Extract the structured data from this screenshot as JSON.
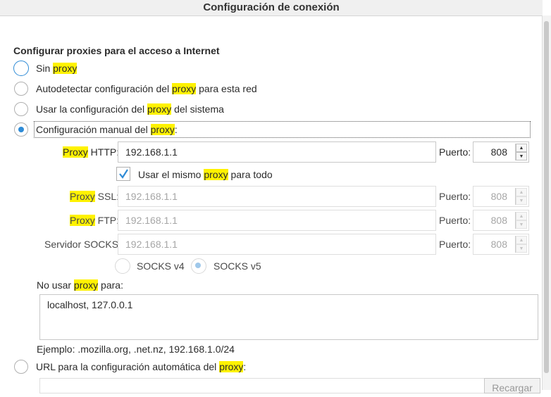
{
  "dialog": {
    "title": "Configuración de conexión"
  },
  "section": {
    "title": "Configurar proxies para el acceso a Internet"
  },
  "options": {
    "no_proxy": {
      "pre": "Sin ",
      "hl": "proxy",
      "post": ""
    },
    "auto_detect": {
      "pre": "Autodetectar configuración del ",
      "hl": "proxy",
      "post": " para esta red"
    },
    "system": {
      "pre": "Usar la configuración del ",
      "hl": "proxy",
      "post": " del sistema"
    },
    "manual": {
      "pre": "Configuración manual del ",
      "hl": "proxy",
      "post": ":"
    },
    "auto_url": {
      "pre": "URL para la configuración automática del ",
      "hl": "proxy",
      "post": ":"
    }
  },
  "http": {
    "hl": "Proxy",
    "post": " HTTP:",
    "value": "192.168.1.1",
    "port_label": "Puerto:",
    "port": "808"
  },
  "same_proxy": {
    "pre": "Usar el mismo ",
    "hl": "proxy",
    "post": " para todo",
    "checked": true
  },
  "ssl": {
    "hl": "Proxy",
    "post": " SSL:",
    "value": "192.168.1.1",
    "port_label": "Puerto:",
    "port": "808"
  },
  "ftp": {
    "hl": "Proxy",
    "post": " FTP:",
    "value": "192.168.1.1",
    "port_label": "Puerto:",
    "port": "808"
  },
  "socks": {
    "label": "Servidor SOCKS:",
    "value": "192.168.1.1",
    "port_label": "Puerto:",
    "port": "808",
    "v4": "SOCKS v4",
    "v5": "SOCKS v5"
  },
  "no_proxy_for": {
    "pre": "No usar ",
    "hl": "proxy",
    "post": " para:",
    "value": "localhost, 127.0.0.1",
    "example": "Ejemplo: .mozilla.org, .net.nz, 192.168.1.0/24"
  },
  "reload_button": "Recargar",
  "colors": {
    "accent": "#2e8bd6",
    "highlight": "#fff200"
  }
}
